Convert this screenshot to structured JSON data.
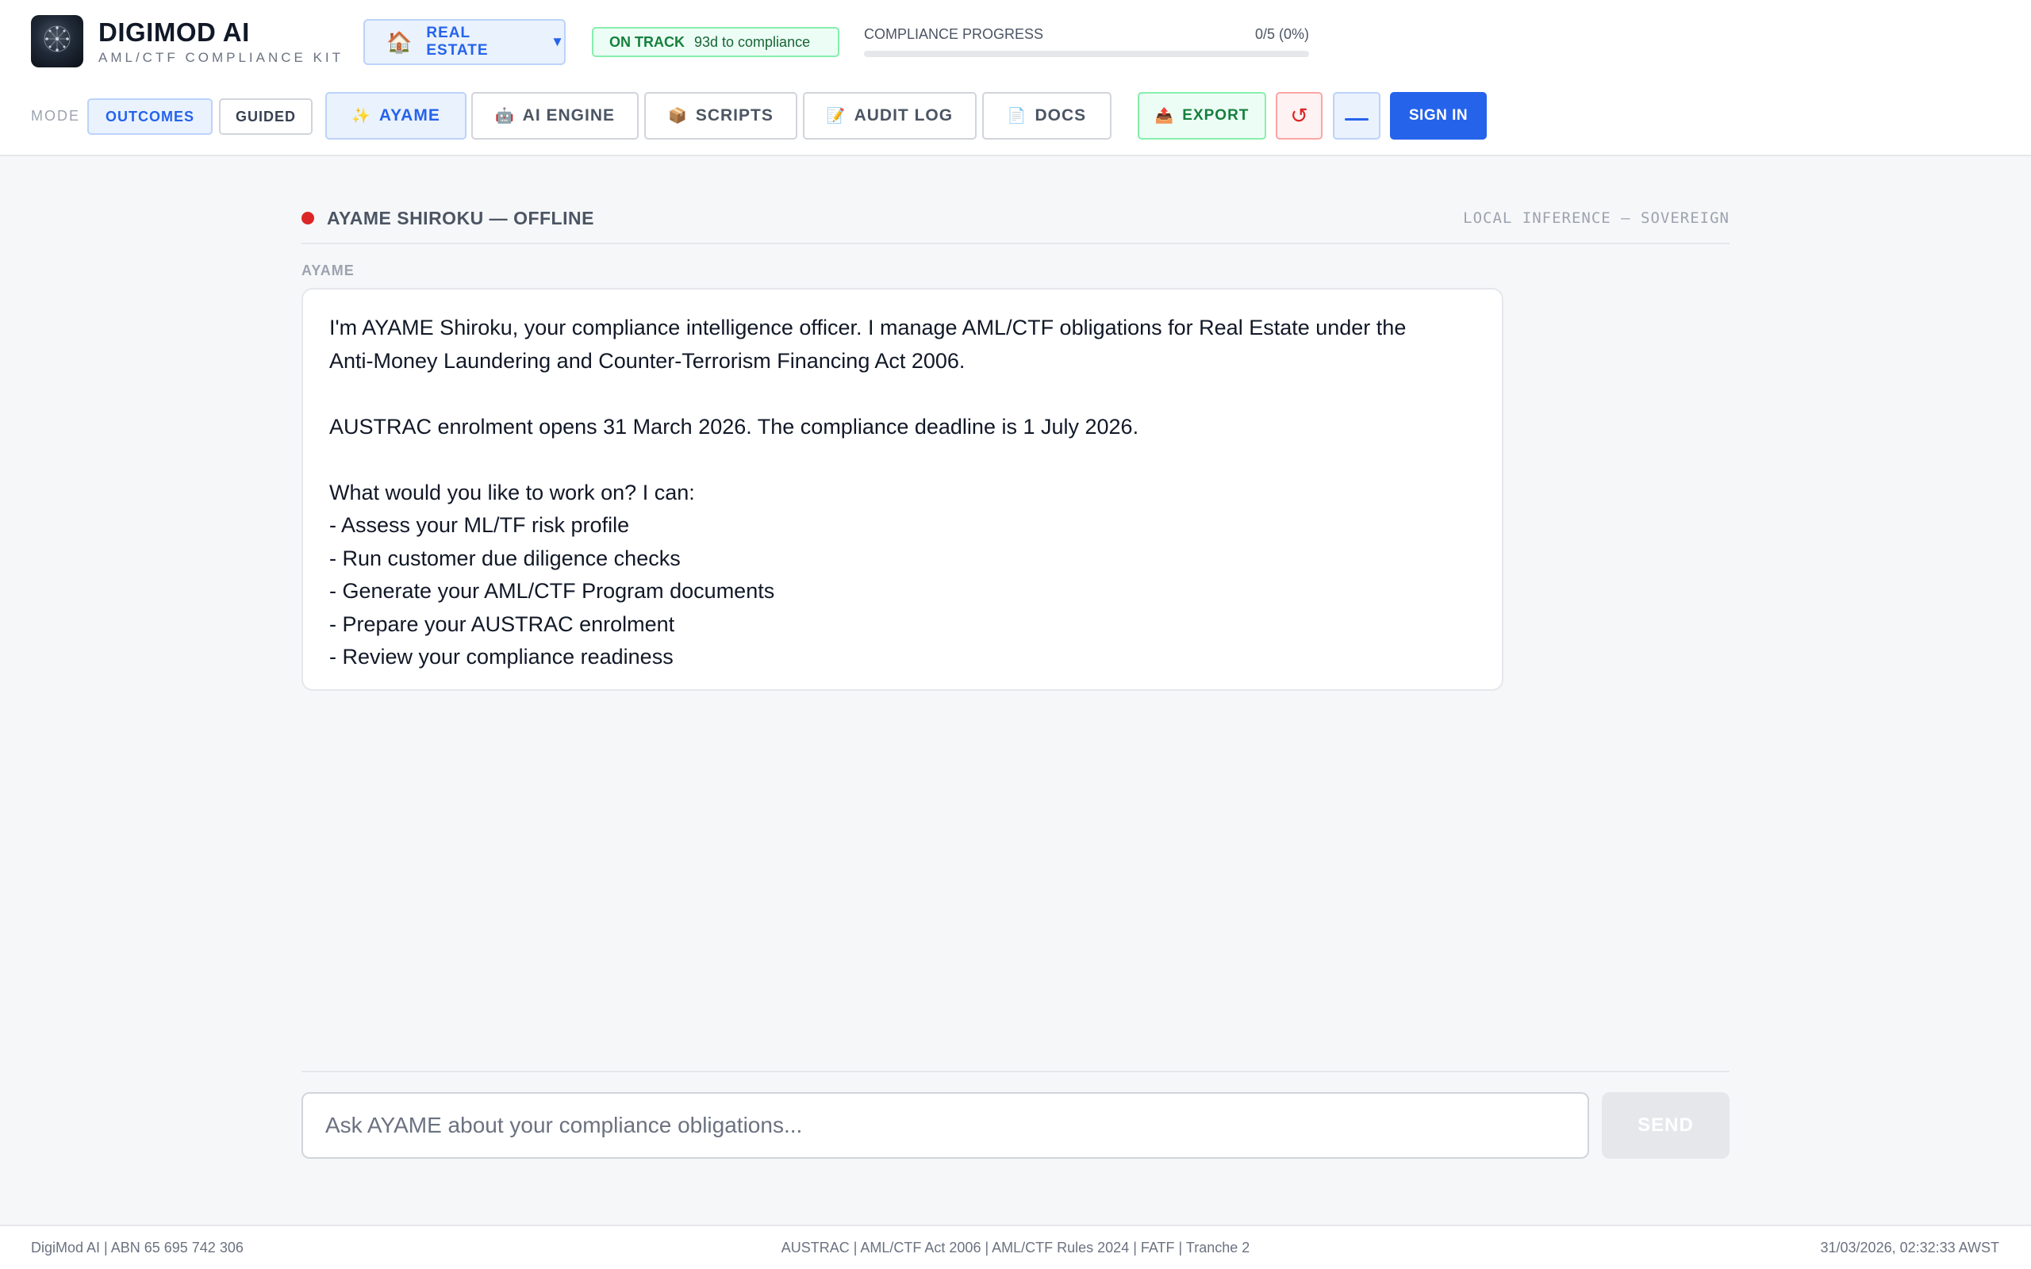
{
  "brand": {
    "name": "DIGIMOD AI",
    "subtitle": "AML/CTF COMPLIANCE KIT",
    "logo_icon": "circuit-brain-icon"
  },
  "sector": {
    "icon": "🏠",
    "label": "REAL ESTATE",
    "caret": "▼"
  },
  "status_pill": {
    "label": "ON TRACK",
    "detail": "93d to compliance",
    "color": "#15803d"
  },
  "progress": {
    "label": "COMPLIANCE PROGRESS",
    "value_text": "0/5 (0%)",
    "percent": 0
  },
  "mode": {
    "label": "MODE",
    "options": [
      "OUTCOMES",
      "GUIDED"
    ],
    "selected": "OUTCOMES"
  },
  "tabs": [
    {
      "icon": "✨",
      "label": "AYAME",
      "active": true
    },
    {
      "icon": "🤖",
      "label": "AI ENGINE",
      "active": false
    },
    {
      "icon": "📦",
      "label": "SCRIPTS",
      "active": false
    },
    {
      "icon": "📝",
      "label": "AUDIT LOG",
      "active": false
    },
    {
      "icon": "📄",
      "label": "DOCS",
      "active": false
    }
  ],
  "actions": {
    "export_icon": "📤",
    "export_label": "EXPORT",
    "reset_icon": "↺",
    "signin_label": "SIGN IN"
  },
  "assistant": {
    "status_name": "AYAME SHIROKU — OFFLINE",
    "status_color": "#dc2626",
    "status_right": "LOCAL INFERENCE — SOVEREIGN"
  },
  "message": {
    "sender": "AYAME",
    "lines": [
      "I'm AYAME Shiroku, your compliance intelligence officer. I manage AML/CTF obligations for Real Estate under the",
      "Anti-Money Laundering and Counter-Terrorism Financing Act 2006.",
      "",
      "AUSTRAC enrolment opens 31 March 2026. The compliance deadline is 1 July 2026.",
      "",
      "What would you like to work on? I can:",
      "- Assess your ML/TF risk profile",
      "- Run customer due diligence checks",
      "- Generate your AML/CTF Program documents",
      "- Prepare your AUSTRAC enrolment",
      "- Review your compliance readiness"
    ]
  },
  "composer": {
    "placeholder": "Ask AYAME about your compliance obligations...",
    "value": "",
    "send_label": "SEND"
  },
  "footer": {
    "left": "DigiMod AI | ABN 65 695 742 306",
    "center": "AUSTRAC | AML/CTF Act 2006 | AML/CTF Rules 2024 | FATF | Tranche 2",
    "right": "31/03/2026, 02:32:33 AWST"
  },
  "colors": {
    "accent": "#2563eb",
    "success": "#15803d",
    "danger": "#dc2626"
  }
}
